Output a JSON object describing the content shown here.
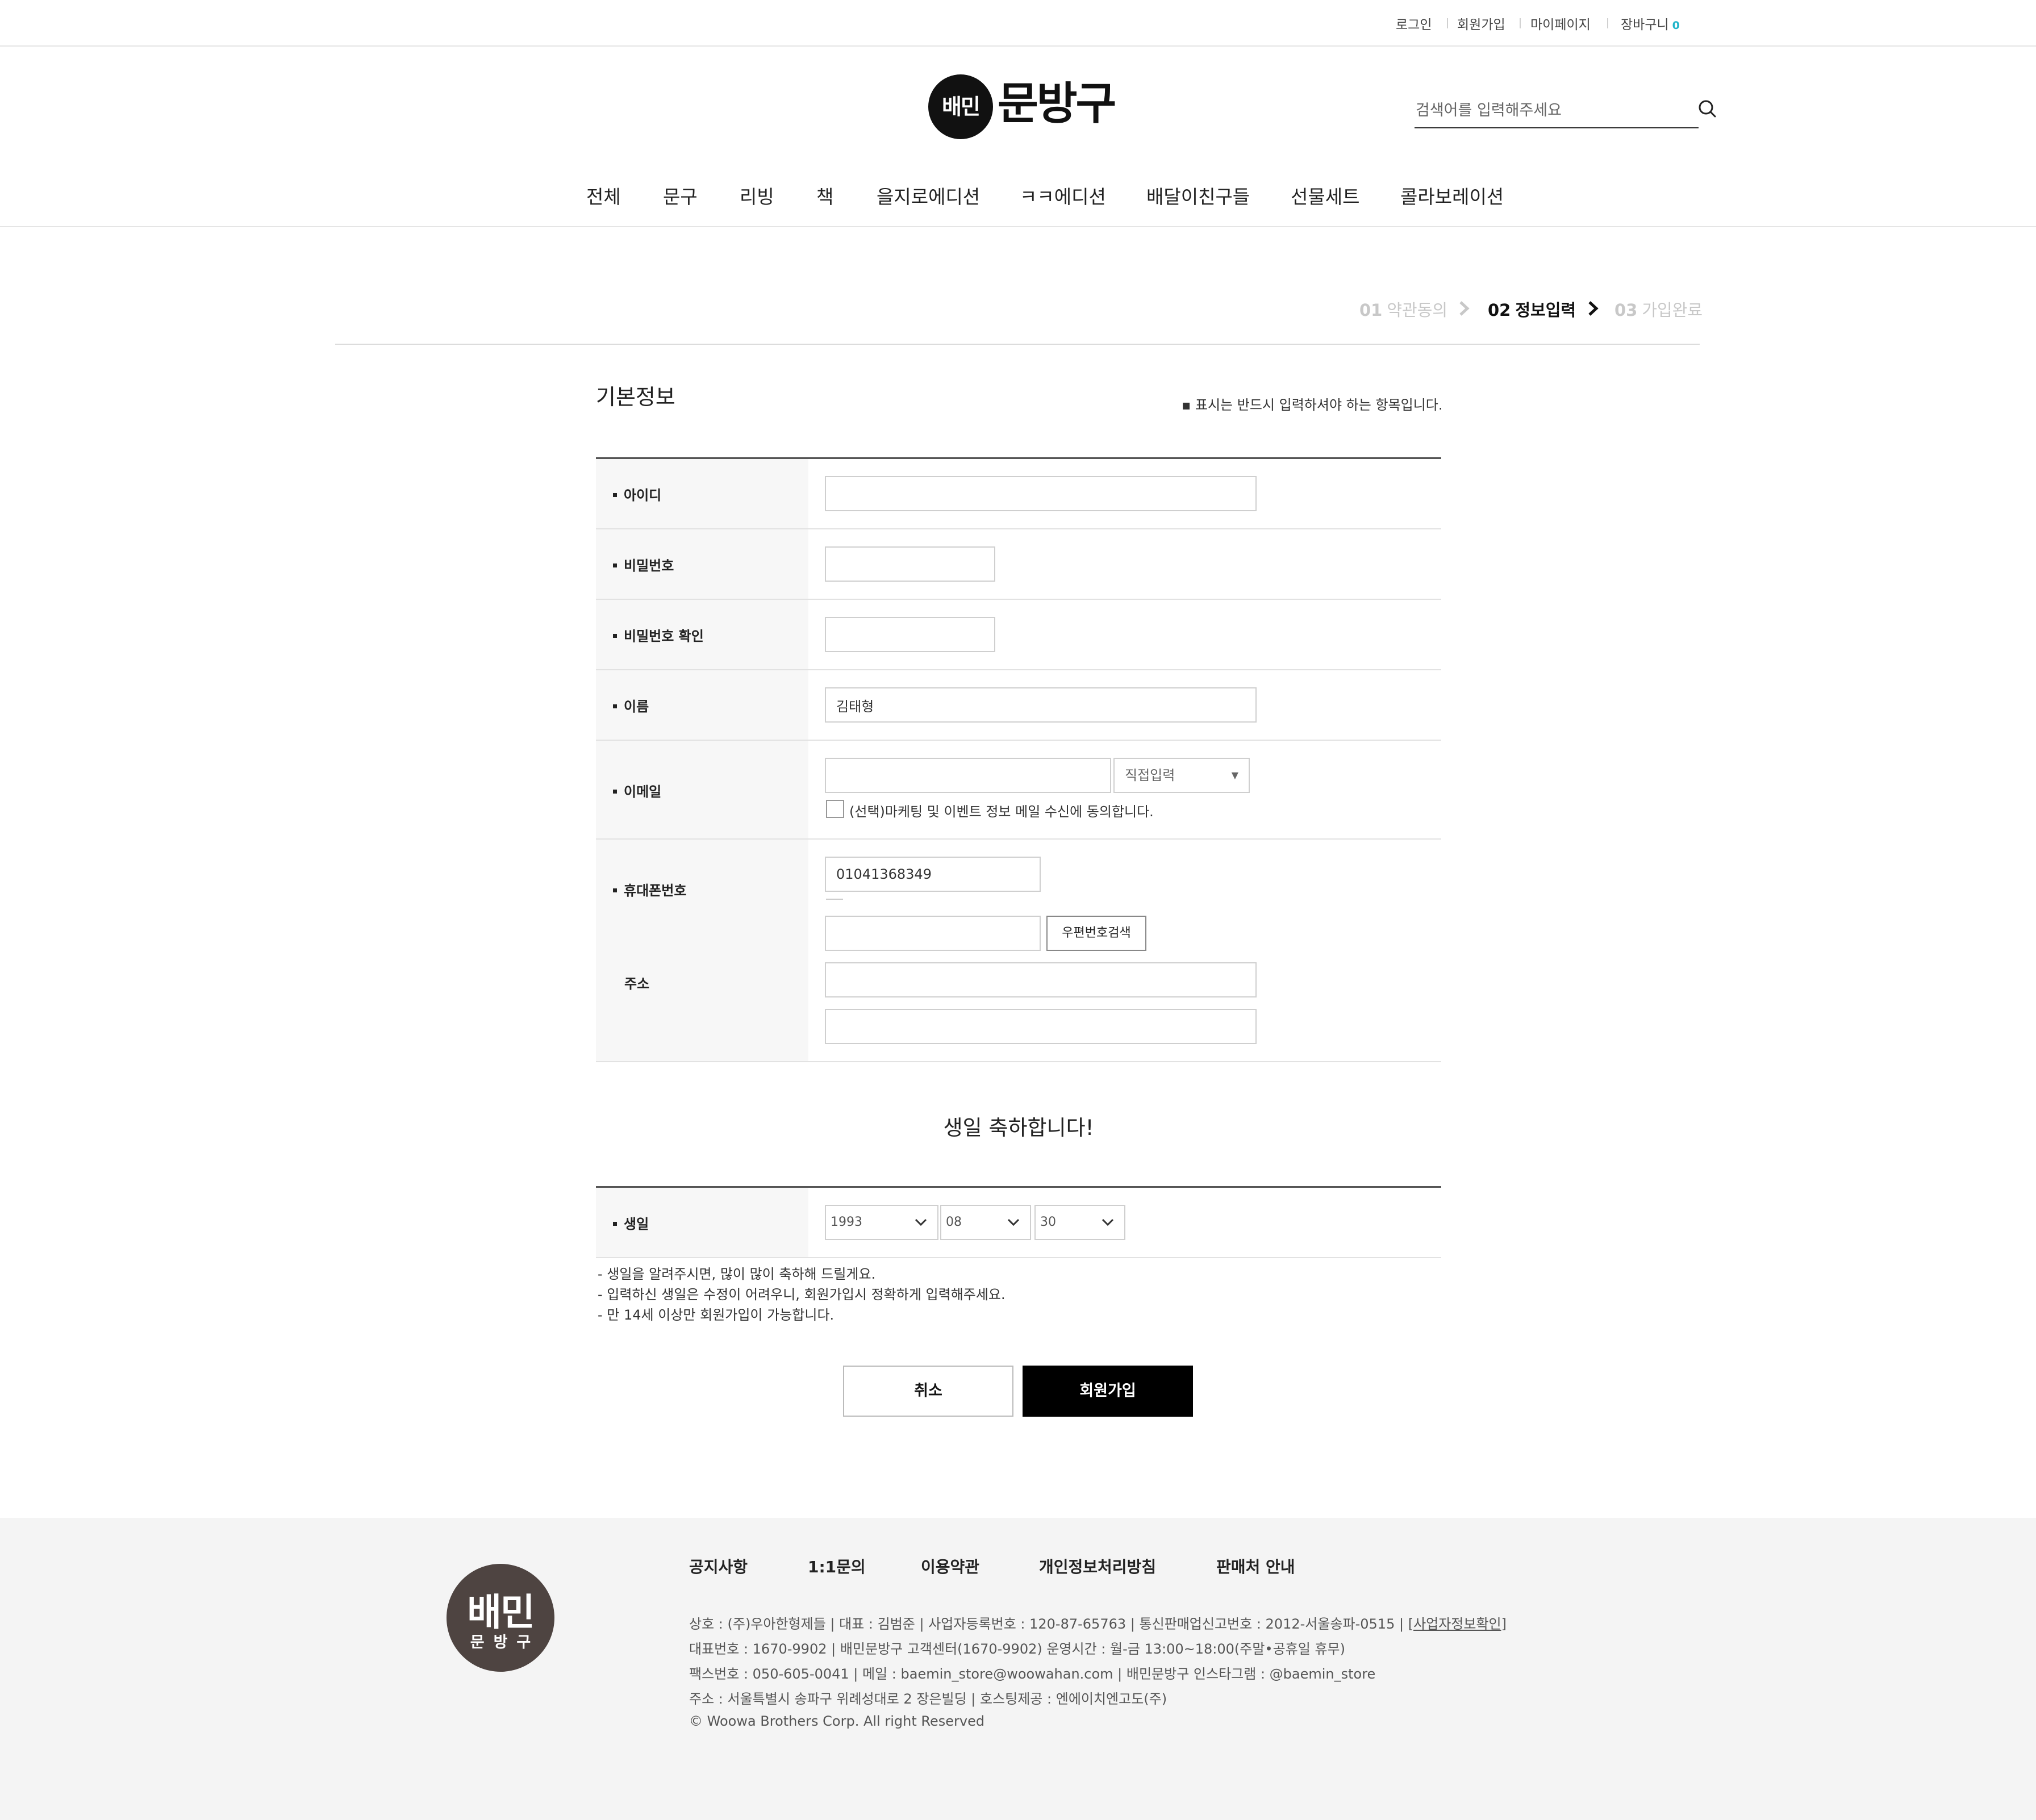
{
  "topbar": {
    "login": "로그인",
    "signup": "회원가입",
    "mypage": "마이페이지",
    "cart": "장바구니",
    "cart_count": "0"
  },
  "logo": {
    "badge": "배민",
    "text": "문방구"
  },
  "search": {
    "placeholder": "검색어를 입력해주세요"
  },
  "nav": {
    "items": [
      "전체",
      "문구",
      "리빙",
      "책",
      "을지로에디션",
      "ㅋㅋ에디션",
      "배달이친구들",
      "선물세트",
      "콜라보레이션"
    ]
  },
  "steps": {
    "s1_num": "01",
    "s1_label": "약관동의",
    "s2_num": "02",
    "s2_label": "정보입력",
    "s3_num": "03",
    "s3_label": "가입완료"
  },
  "form": {
    "section_title": "기본정보",
    "required_note": "▪ 표시는 반드시 입력하셔야 하는 항목입니다.",
    "id_label": "아이디",
    "pw_label": "비밀번호",
    "pw_confirm_label": "비밀번호 확인",
    "name_label": "이름",
    "name_value": "김태형",
    "email_label": "이메일",
    "email_select": "직접입력",
    "marketing_consent": "(선택)마케팅 및 이벤트 정보 메일 수신에 동의합니다.",
    "phone_label": "휴대폰번호",
    "phone_value": "01041368349",
    "address_label": "주소",
    "zipcode_button": "우편번호검색"
  },
  "birthday": {
    "title": "생일 축하합니다!",
    "label": "생일",
    "year": "1993",
    "month": "08",
    "day": "30",
    "notes": [
      "- 생일을 알려주시면, 많이 많이 축하해 드릴게요.",
      "- 입력하신 생일은 수정이 어려우니, 회원가입시 정확하게 입력해주세요.",
      "- 만 14세 이상만 회원가입이 가능합니다."
    ]
  },
  "buttons": {
    "cancel": "취소",
    "join": "회원가입"
  },
  "footer": {
    "logo_line1": "배민",
    "logo_line2": "문방구",
    "links": [
      "공지사항",
      "1:1문의",
      "이용약관",
      "개인정보처리방침",
      "판매처 안내"
    ],
    "info1": "상호 : (주)우아한형제들  |  대표 : 김범준  |  사업자등록번호 : 120-87-65763  |  통신판매업신고번호 : 2012-서울송파-0515  |",
    "info1_link": "[사업자정보확인]",
    "info2": "대표번호 : 1670-9902  |  배민문방구 고객센터(1670-9902) 운영시간 : 월-금 13:00~18:00(주말•공휴일 휴무)",
    "info3": "팩스번호 : 050-605-0041  |  메일 : baemin_store@woowahan.com  |  배민문방구 인스타그램 : @baemin_store",
    "info4": "주소 : 서울특별시 송파구 위례성대로 2 장은빌딩  |  호스팅제공 : 엔에이치엔고도(주)",
    "copyright": "© Woowa Brothers Corp. All right Reserved"
  },
  "colors": {
    "accent_cart": "#1fb4c9",
    "footer_logo": "#4e4441",
    "primary_button": "#000000"
  }
}
